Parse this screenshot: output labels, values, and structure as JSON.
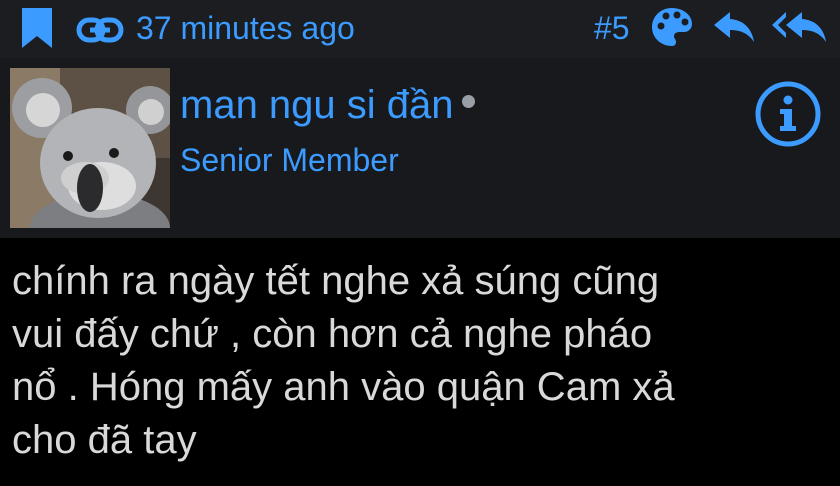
{
  "header": {
    "time": "37 minutes ago",
    "post_number": "#5",
    "icons": [
      "bookmark-icon",
      "link-icon",
      "palette-icon",
      "reply-icon",
      "reply-all-icon"
    ],
    "accent_color": "#3b9bff"
  },
  "user": {
    "name": "man ngu si đần",
    "rank": "Senior Member",
    "online": true,
    "avatar": "koala"
  },
  "post": {
    "lines": [
      "chính ra ngày tết nghe xả súng cũng",
      "vui đấy chứ , còn hơn cả nghe pháo",
      "nổ . Hóng mấy anh vào quận Cam xả",
      "cho đã tay"
    ]
  }
}
